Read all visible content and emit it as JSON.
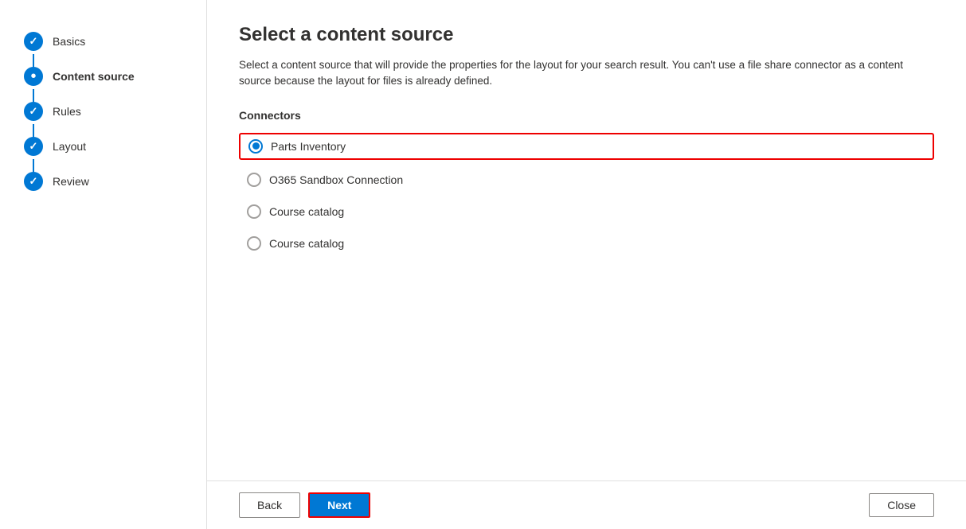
{
  "sidebar": {
    "steps": [
      {
        "id": "basics",
        "label": "Basics",
        "state": "completed"
      },
      {
        "id": "content-source",
        "label": "Content source",
        "state": "active"
      },
      {
        "id": "rules",
        "label": "Rules",
        "state": "completed"
      },
      {
        "id": "layout",
        "label": "Layout",
        "state": "completed"
      },
      {
        "id": "review",
        "label": "Review",
        "state": "completed"
      }
    ]
  },
  "main": {
    "title": "Select a content source",
    "description": "Select a content source that will provide the properties for the layout for your search result. You can't use a file share connector as a content source because the layout for files is already defined.",
    "connectors_label": "Connectors",
    "connectors": [
      {
        "id": "parts-inventory",
        "label": "Parts Inventory",
        "selected": true
      },
      {
        "id": "o365-sandbox",
        "label": "O365 Sandbox Connection",
        "selected": false
      },
      {
        "id": "course-catalog-1",
        "label": "Course catalog",
        "selected": false
      },
      {
        "id": "course-catalog-2",
        "label": "Course catalog",
        "selected": false
      }
    ]
  },
  "footer": {
    "back_label": "Back",
    "next_label": "Next",
    "close_label": "Close"
  }
}
